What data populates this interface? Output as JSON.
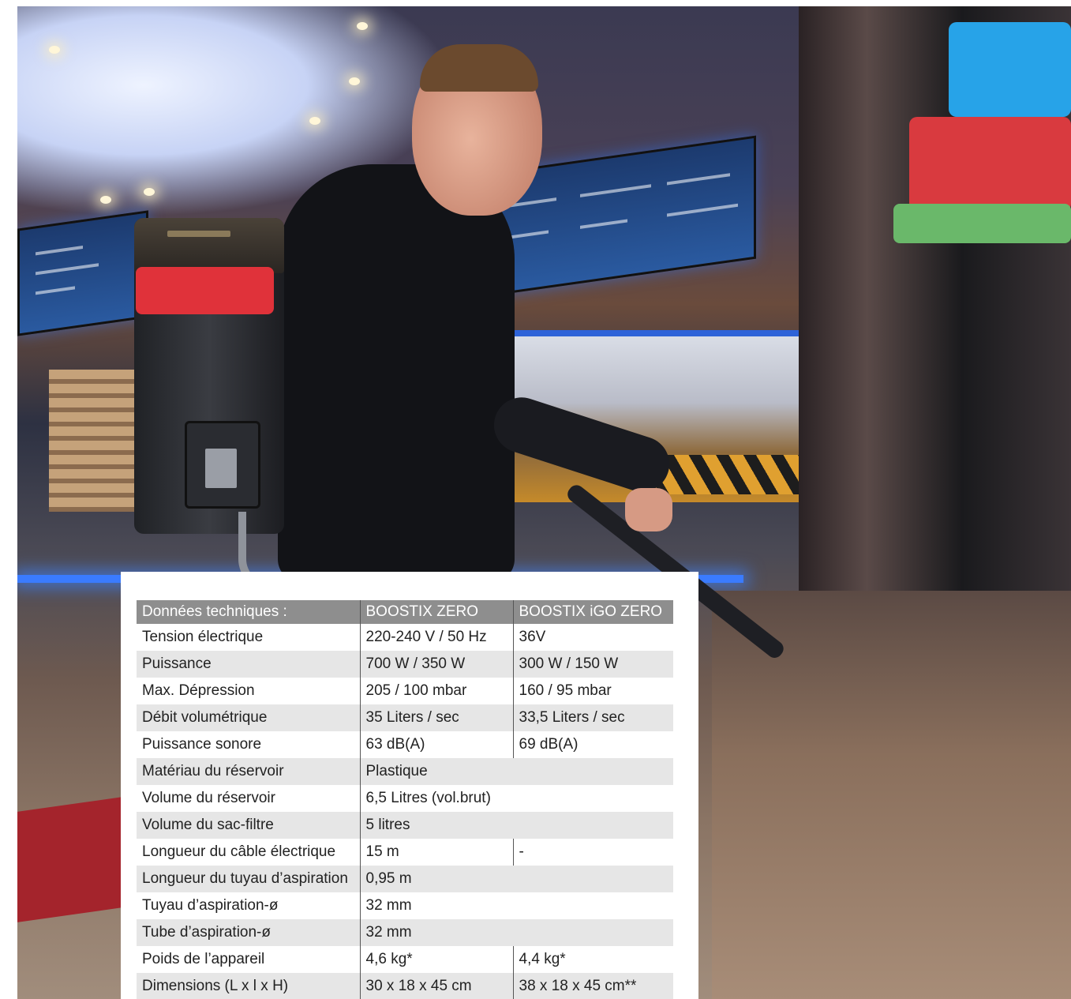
{
  "spec_table": {
    "headers": [
      "Données techniques :",
      "BOOSTIX ZERO",
      "BOOSTIX iGO ZERO"
    ],
    "rows": [
      {
        "label": "Tension électrique",
        "zero": "220-240 V / 50 Hz",
        "igo": "36V"
      },
      {
        "label": "Puissance",
        "zero": "700 W / 350 W",
        "igo": "300 W / 150 W"
      },
      {
        "label": "Max. Dépression",
        "zero": "205 / 100 mbar",
        "igo": "160 / 95 mbar"
      },
      {
        "label": "Débit volumétrique",
        "zero": "35 Liters / sec",
        "igo": "33,5 Liters / sec"
      },
      {
        "label": "Puissance sonore",
        "zero": "63 dB(A)",
        "igo": "69 dB(A)"
      },
      {
        "label": "Matériau du réservoir",
        "shared": "Plastique"
      },
      {
        "label": "Volume du réservoir",
        "shared": "6,5 Litres (vol.brut)"
      },
      {
        "label": "Volume du sac-filtre",
        "shared": "5 litres"
      },
      {
        "label": "Longueur du câble électrique",
        "zero": "15 m",
        "igo": "-"
      },
      {
        "label": "Longueur du tuyau d’aspiration",
        "shared": "0,95 m"
      },
      {
        "label": "Tuyau d’aspiration-ø",
        "shared": "32 mm"
      },
      {
        "label": "Tube d’aspiration-ø",
        "shared": "32 mm"
      },
      {
        "label": "Poids de l’appareil",
        "zero": "4,6 kg*",
        "igo": "4,4 kg*"
      },
      {
        "label": "Dimensions (L x l x H)",
        "zero": "30 x 18 x 45 cm",
        "igo": "38 x 18 x 45 cm**"
      }
    ]
  },
  "colors": {
    "header_bg": "#8e8e8e",
    "stripe_bg": "#e6e6e6",
    "backpack_accent": "#e0323a"
  }
}
